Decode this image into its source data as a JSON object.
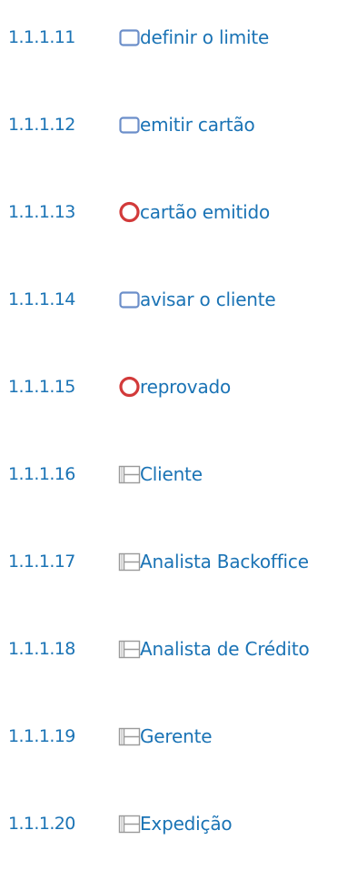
{
  "entries": [
    {
      "number": "1.1.1.11",
      "icon": "task-icon",
      "label": "definir o limite"
    },
    {
      "number": "1.1.1.12",
      "icon": "task-icon",
      "label": "emitir cartão"
    },
    {
      "number": "1.1.1.13",
      "icon": "end-event-icon",
      "label": "cartão emitido"
    },
    {
      "number": "1.1.1.14",
      "icon": "task-icon",
      "label": "avisar o cliente"
    },
    {
      "number": "1.1.1.15",
      "icon": "end-event-icon",
      "label": "reprovado"
    },
    {
      "number": "1.1.1.16",
      "icon": "lane-icon",
      "label": "Cliente"
    },
    {
      "number": "1.1.1.17",
      "icon": "lane-icon",
      "label": "Analista Backoffice"
    },
    {
      "number": "1.1.1.18",
      "icon": "lane-icon",
      "label": "Analista de Crédito"
    },
    {
      "number": "1.1.1.19",
      "icon": "lane-icon",
      "label": "Gerente"
    },
    {
      "number": "1.1.1.20",
      "icon": "lane-icon",
      "label": "Expedição"
    }
  ],
  "colors": {
    "link": "#1a73b5",
    "task_border": "#6b8ec9",
    "end_event": "#d23a3a",
    "lane": "#9a9a9a"
  }
}
